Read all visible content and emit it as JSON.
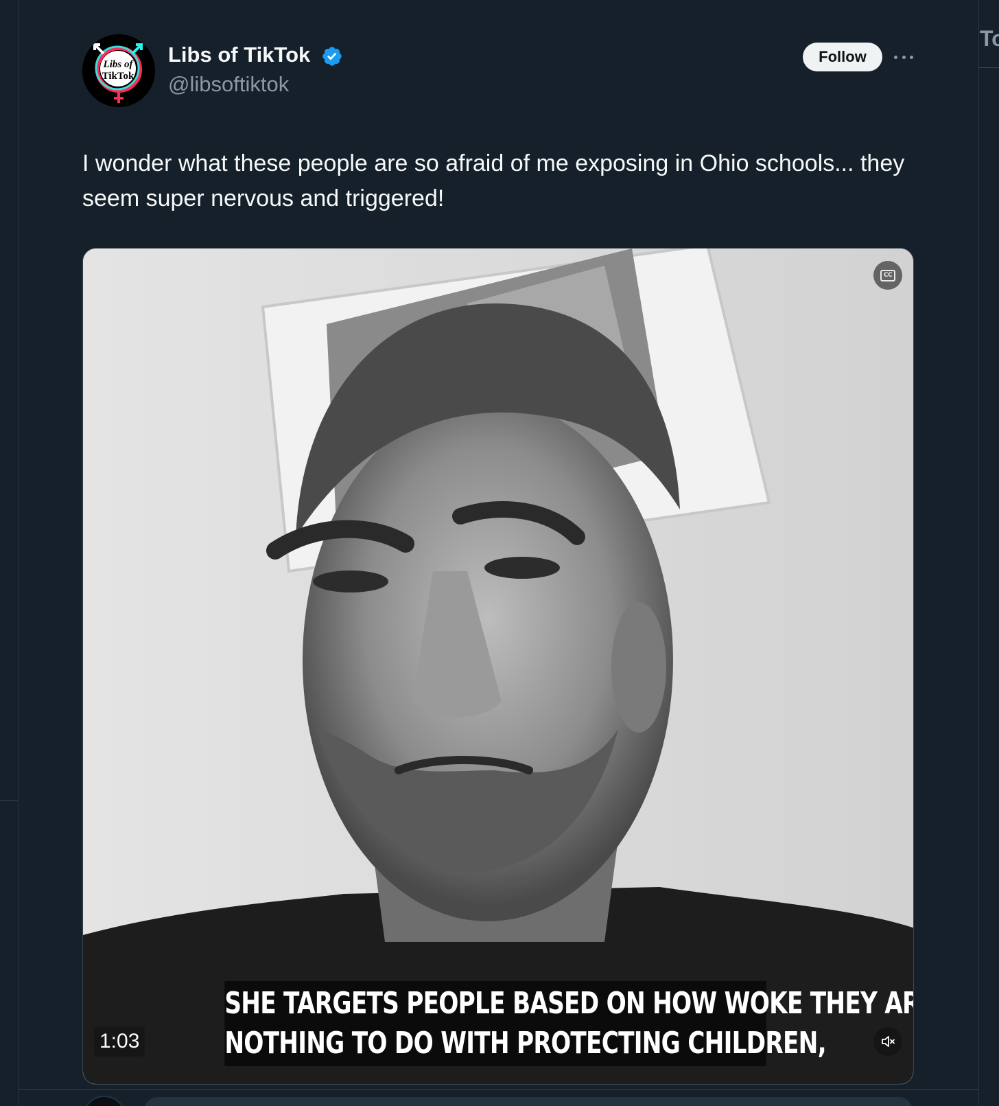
{
  "account": {
    "display_name": "Libs of TikTok",
    "handle": "@libsoftiktok",
    "verified": true,
    "avatar_text_line1": "Libs of",
    "avatar_text_line2": "TikTok"
  },
  "actions": {
    "follow_label": "Follow",
    "more_icon": "more-horizontal-icon"
  },
  "post": {
    "text": "I wonder what these people are so afraid of me exposing in Ohio schools... they seem super nervous and triggered!"
  },
  "video": {
    "caption_line1": "SHE TARGETS PEOPLE BASED ON HOW WOKE THEY ARE, HAS",
    "caption_line2": "NOTHING TO DO WITH PROTECTING CHILDREN,",
    "duration": "1:03",
    "cc_icon": "closed-captions-icon",
    "mute_icon": "muted-speaker-icon"
  },
  "sidebar_peek": {
    "text": "To"
  },
  "colors": {
    "background": "#15202b",
    "text_primary": "#f7f9f9",
    "text_secondary": "#8b98a5",
    "verified_blue": "#1d9bf0",
    "follow_bg": "#eff3f4",
    "avatar_cyan": "#25f4ee",
    "avatar_pink": "#fe2c55"
  }
}
